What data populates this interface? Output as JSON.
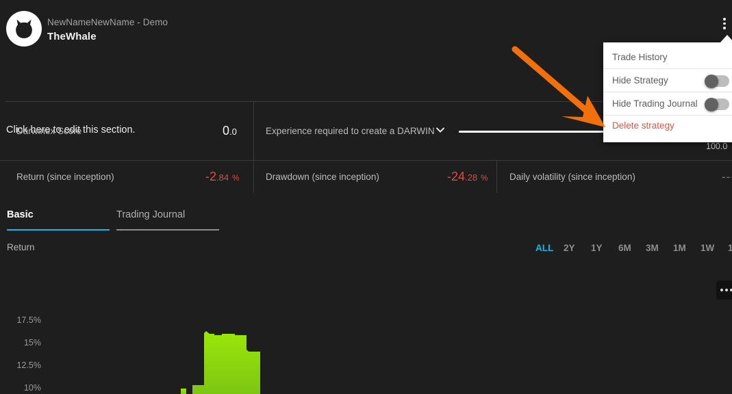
{
  "header": {
    "account_subtitle": "NewNameNewName - Demo",
    "account_name": "TheWhale",
    "logo_icon": "darwinex-cat-logo",
    "kebab_icon": "vertical-dots-icon"
  },
  "edit_section": {
    "label": "Click here to edit this section.",
    "chevron_icon": "chevron-down-icon"
  },
  "stats": {
    "row1": [
      {
        "label": "Darwinex Score",
        "value_major": "0",
        "value_minor": ".0"
      },
      {
        "label": "Experience required to create a DARWIN",
        "progress_max": "100.0"
      }
    ],
    "row2": [
      {
        "label": "Return (since inception)",
        "value_major": "-2",
        "value_minor": ".84",
        "unit": "%",
        "tone": "negative"
      },
      {
        "label": "Drawdown (since inception)",
        "value_major": "-24",
        "value_minor": ".28",
        "unit": "%",
        "tone": "negative"
      },
      {
        "label": "Daily volatility (since inception)",
        "value_major": "---",
        "tone": "muted"
      }
    ]
  },
  "tabs": [
    {
      "label": "Basic",
      "active": true
    },
    {
      "label": "Trading Journal",
      "active": false
    }
  ],
  "chart_section": {
    "title": "Return",
    "menu_icon": "horizontal-dots-icon",
    "ranges": [
      {
        "label": "ALL",
        "active": true
      },
      {
        "label": "2Y",
        "active": false
      },
      {
        "label": "1Y",
        "active": false
      },
      {
        "label": "6M",
        "active": false
      },
      {
        "label": "3M",
        "active": false
      },
      {
        "label": "1M",
        "active": false
      },
      {
        "label": "1W",
        "active": false
      },
      {
        "label": "1",
        "active": false
      }
    ]
  },
  "chart_data": {
    "type": "area",
    "title": "Return",
    "xlabel": "",
    "ylabel": "",
    "ylim": [
      9,
      18.75
    ],
    "grid": false,
    "legend": null,
    "series_color": "#8fd908",
    "yticks": [
      "17.5%",
      "15%",
      "12.5%",
      "10%"
    ],
    "ytick_values": [
      17.5,
      15,
      12.5,
      10
    ],
    "x": [
      0,
      1,
      2,
      3,
      4,
      5,
      6,
      7,
      8,
      9,
      10,
      11,
      12,
      13
    ],
    "values": [
      9.0,
      9.0,
      9.0,
      9.0,
      9.35,
      9.0,
      10.4,
      10.55,
      16.8,
      16.4,
      16.5,
      16.45,
      16.35,
      12.6
    ]
  },
  "menu": {
    "items": [
      {
        "label": "Trade History",
        "type": "link"
      },
      {
        "label": "Hide Strategy",
        "type": "toggle",
        "on": false
      },
      {
        "label": "Hide Trading Journal",
        "type": "toggle",
        "on": false
      },
      {
        "label": "Delete strategy",
        "type": "danger"
      }
    ]
  },
  "annotation": {
    "arrow_color": "#f2700c",
    "arrow_icon": "pointer-arrow"
  },
  "colors": {
    "background": "#1e1e1e",
    "accent": "#1ab5e8",
    "negative": "#e24b3b",
    "chart_green": "#8fd908",
    "menu_bg": "#ffffff",
    "danger": "#d4594b"
  }
}
